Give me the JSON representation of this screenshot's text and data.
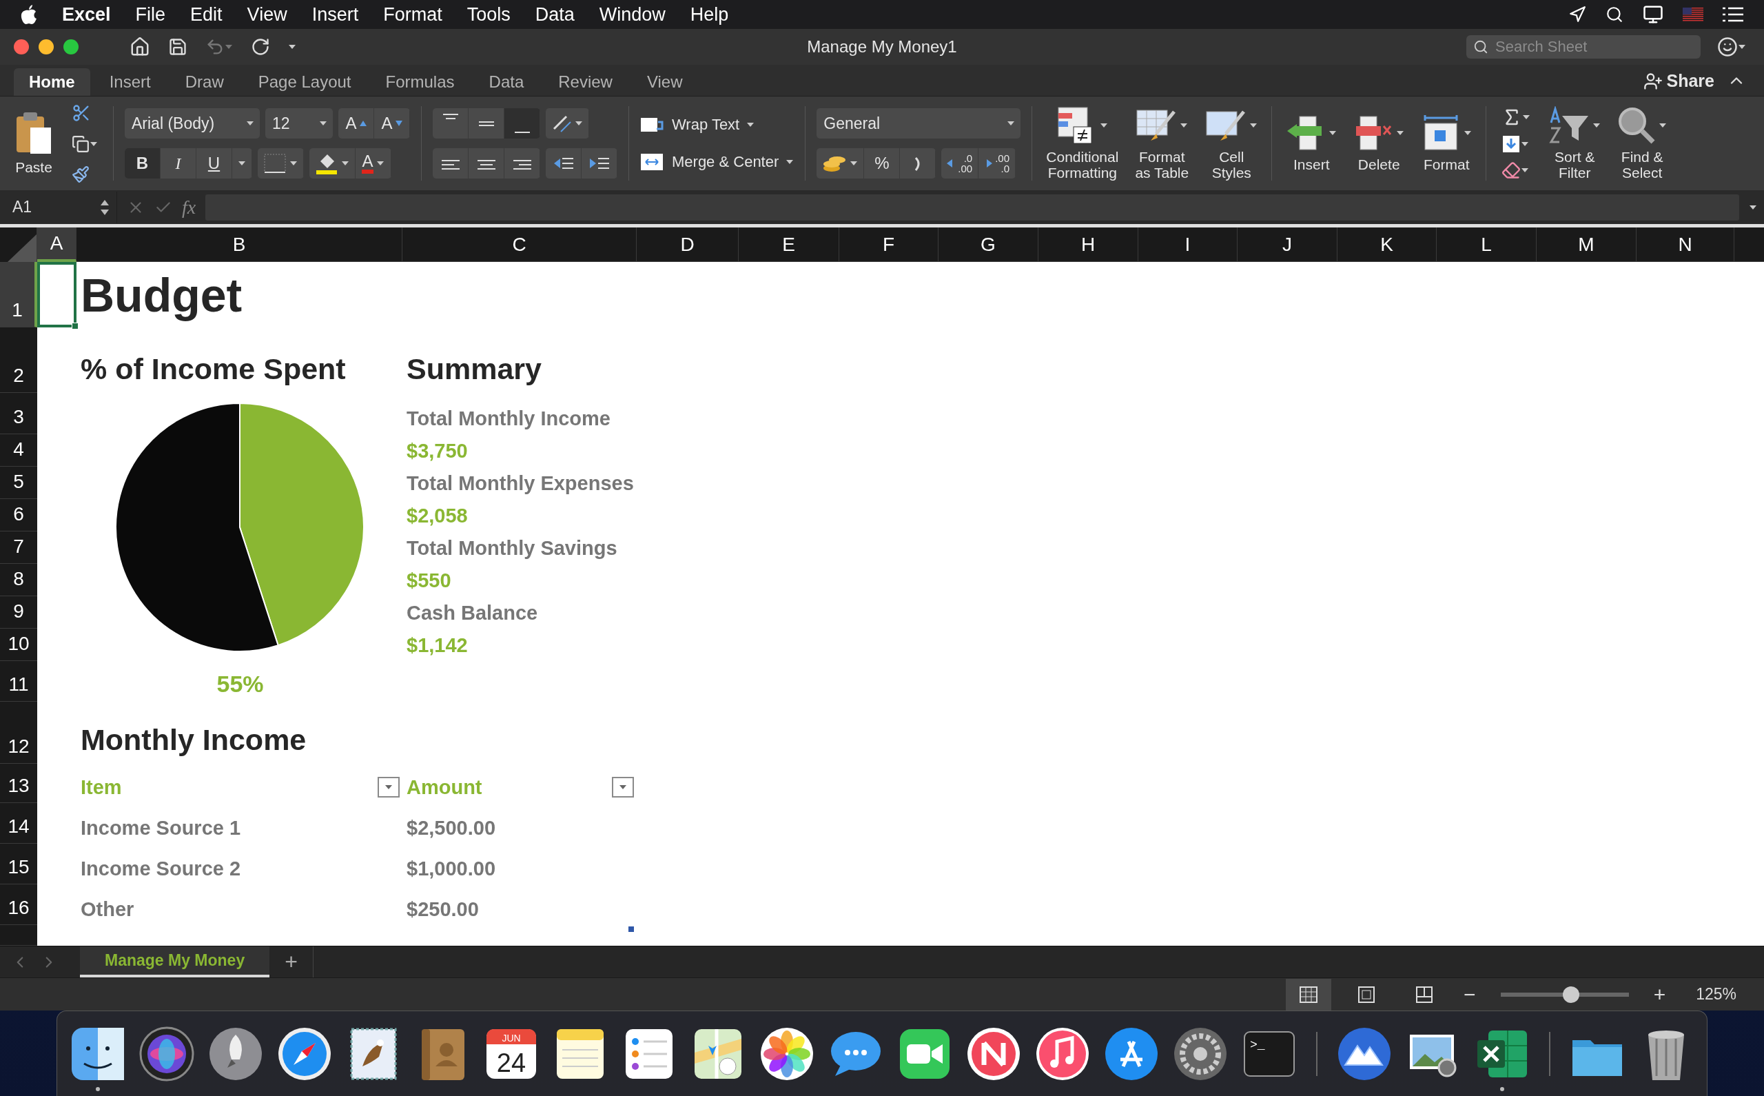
{
  "menubar": {
    "app": "Excel",
    "items": [
      "File",
      "Edit",
      "View",
      "Insert",
      "Format",
      "Tools",
      "Data",
      "Window",
      "Help"
    ]
  },
  "window": {
    "title": "Manage My Money1",
    "search": {
      "placeholder": "Search Sheet"
    },
    "share": "Share"
  },
  "tabs": [
    {
      "label": "Home",
      "selected": true
    },
    {
      "label": "Insert",
      "selected": false
    },
    {
      "label": "Draw",
      "selected": false
    },
    {
      "label": "Page Layout",
      "selected": false
    },
    {
      "label": "Formulas",
      "selected": false
    },
    {
      "label": "Data",
      "selected": false
    },
    {
      "label": "Review",
      "selected": false
    },
    {
      "label": "View",
      "selected": false
    }
  ],
  "ribbon": {
    "paste": "Paste",
    "font": "Arial (Body)",
    "font_size": "12",
    "grow_font": "A",
    "shrink_font": "A",
    "bold": "B",
    "italic": "I",
    "underline": "U",
    "font_color": "A",
    "wrap_text": "Wrap Text",
    "merge": "Merge & Center",
    "number_format": "General",
    "percent": "%",
    "increase_decimal": [
      ".0",
      ".00"
    ],
    "decrease_decimal": [
      ".00",
      ".0"
    ],
    "buttons": [
      {
        "kind": "conditional",
        "label": "Conditional\nFormatting"
      },
      {
        "kind": "table",
        "label": "Format\nas Table"
      },
      {
        "kind": "styles",
        "label": "Cell\nStyles"
      },
      {
        "kind": "insert",
        "label": "Insert"
      },
      {
        "kind": "delete",
        "label": "Delete"
      },
      {
        "kind": "format",
        "label": "Format"
      },
      {
        "kind": "sort",
        "label": "Sort &\nFilter"
      },
      {
        "kind": "find",
        "label": "Find &\nSelect"
      }
    ]
  },
  "formula_bar": {
    "name_box": "A1",
    "fx": "fx"
  },
  "sheet": {
    "columns": [
      {
        "label": "A",
        "selected": true
      },
      {
        "label": "B",
        "selected": false
      },
      {
        "label": "C",
        "selected": false
      },
      {
        "label": "D",
        "selected": false
      },
      {
        "label": "E",
        "selected": false
      },
      {
        "label": "F",
        "selected": false
      },
      {
        "label": "G",
        "selected": false
      },
      {
        "label": "H",
        "selected": false
      },
      {
        "label": "I",
        "selected": false
      },
      {
        "label": "J",
        "selected": false
      },
      {
        "label": "K",
        "selected": false
      },
      {
        "label": "L",
        "selected": false
      },
      {
        "label": "M",
        "selected": false
      },
      {
        "label": "N",
        "selected": false
      }
    ],
    "rows": [
      {
        "number": "1",
        "selected": true,
        "B": {
          "kind": "title",
          "text": "Budget"
        }
      },
      {
        "number": "2",
        "selected": false,
        "B": {
          "kind": "heading",
          "text": "% of Income Spent"
        },
        "C": {
          "kind": "heading",
          "text": "Summary"
        }
      },
      {
        "number": "3",
        "selected": false,
        "C": {
          "kind": "label",
          "text": "Total Monthly Income"
        }
      },
      {
        "number": "4",
        "selected": false,
        "C": {
          "kind": "value",
          "text": "$3,750"
        }
      },
      {
        "number": "5",
        "selected": false,
        "C": {
          "kind": "label",
          "text": "Total Monthly Expenses"
        }
      },
      {
        "number": "6",
        "selected": false,
        "C": {
          "kind": "value",
          "text": "$2,058"
        }
      },
      {
        "number": "7",
        "selected": false,
        "C": {
          "kind": "label",
          "text": "Total Monthly Savings"
        }
      },
      {
        "number": "8",
        "selected": false,
        "C": {
          "kind": "value",
          "text": "$550"
        }
      },
      {
        "number": "9",
        "selected": false,
        "C": {
          "kind": "label",
          "text": "Cash Balance"
        }
      },
      {
        "number": "10",
        "selected": false,
        "C": {
          "kind": "value",
          "text": "$1,142"
        }
      },
      {
        "number": "11",
        "selected": false,
        "B": {
          "kind": "percent",
          "text": "55%"
        }
      },
      {
        "number": "12",
        "selected": false,
        "B": {
          "kind": "heading",
          "text": "Monthly Income"
        }
      },
      {
        "number": "13",
        "selected": false,
        "B": {
          "kind": "header",
          "text": "Item",
          "filter": true
        },
        "C": {
          "kind": "header",
          "text": "Amount",
          "filter": true
        }
      },
      {
        "number": "14",
        "selected": false,
        "B": {
          "kind": "item",
          "text": "Income Source 1"
        },
        "C": {
          "kind": "item",
          "text": "$2,500.00"
        }
      },
      {
        "number": "15",
        "selected": false,
        "B": {
          "kind": "item",
          "text": "Income Source 2"
        },
        "C": {
          "kind": "item",
          "text": "$1,000.00"
        }
      },
      {
        "number": "16",
        "selected": false,
        "B": {
          "kind": "item",
          "text": "Other"
        },
        "C": {
          "kind": "item",
          "text": "$250.00"
        }
      }
    ],
    "chart_data": {
      "type": "pie",
      "values": [
        45,
        55
      ]
    }
  },
  "sheet_tabs": [
    {
      "label": "Manage My Money",
      "selected": true
    }
  ],
  "add_sheet": "+",
  "status_bar": {
    "views": [
      {
        "kind": "normal",
        "selected": true
      },
      {
        "kind": "page_layout",
        "selected": false
      },
      {
        "kind": "page_break",
        "selected": false
      }
    ],
    "zoom_out": "−",
    "zoom_in": "+",
    "level": 0.55,
    "zoom": "125%"
  },
  "dock": [
    {
      "kind": "finder",
      "running": true
    },
    {
      "kind": "siri",
      "running": false
    },
    {
      "kind": "launchpad",
      "running": false
    },
    {
      "kind": "safari",
      "running": false
    },
    {
      "kind": "mail",
      "running": false
    },
    {
      "kind": "contacts",
      "running": false
    },
    {
      "kind": "calendar",
      "running": false,
      "month": "JUN",
      "day": "24"
    },
    {
      "kind": "notes",
      "running": false
    },
    {
      "kind": "reminders",
      "running": false
    },
    {
      "kind": "maps",
      "running": false
    },
    {
      "kind": "photos",
      "running": false
    },
    {
      "kind": "messages",
      "running": false
    },
    {
      "kind": "facetime",
      "running": false
    },
    {
      "kind": "news",
      "running": false
    },
    {
      "kind": "music",
      "running": false
    },
    {
      "kind": "appstore",
      "running": false
    },
    {
      "kind": "preferences",
      "running": false
    },
    {
      "kind": "terminal",
      "running": false,
      "prompt": ">_"
    },
    {
      "kind": "separator"
    },
    {
      "kind": "mountain",
      "running": false
    },
    {
      "kind": "preview",
      "running": false
    },
    {
      "kind": "excel",
      "running": true
    },
    {
      "kind": "separator"
    },
    {
      "kind": "folder",
      "running": false
    },
    {
      "kind": "trash",
      "running": false
    }
  ]
}
